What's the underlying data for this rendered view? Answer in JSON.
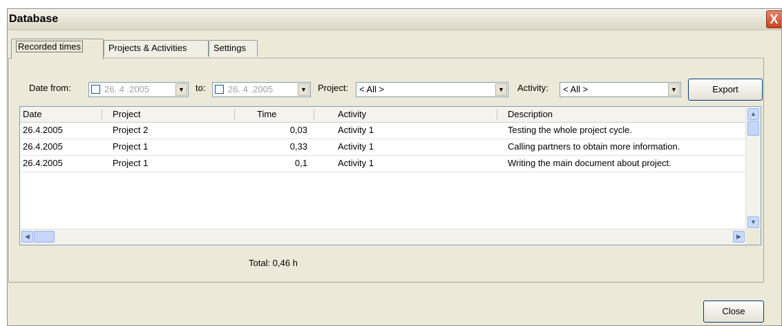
{
  "window": {
    "title": "Database",
    "close_glyph": "X"
  },
  "tabs": [
    {
      "label": "Recorded times",
      "active": true
    },
    {
      "label": "Projects & Activities",
      "active": false
    },
    {
      "label": "Settings",
      "active": false
    }
  ],
  "filters": {
    "date_from_label": "Date from:",
    "date_from_value": "26. 4 .2005",
    "to_label": "to:",
    "to_value": "26. 4 .2005",
    "project_label": "Project:",
    "project_value": "< All >",
    "activity_label": "Activity:",
    "activity_value": "< All >",
    "export_label": "Export"
  },
  "table": {
    "columns": [
      "Date",
      "Project",
      "Time",
      "Activity",
      "Description"
    ],
    "rows": [
      [
        "26.4.2005",
        "Project 2",
        "0,03",
        "Activity 1",
        "Testing the whole project cycle."
      ],
      [
        "26.4.2005",
        "Project 1",
        "0,33",
        "Activity 1",
        "Calling partners to obtain more information."
      ],
      [
        "26.4.2005",
        "Project 1",
        "0,1",
        "Activity 1",
        "Writing the main document about project."
      ]
    ]
  },
  "total_text": "Total: 0,46 h",
  "close_button_label": "Close",
  "icons": {
    "dropdown": "dropdown-arrow-icon",
    "scroll_up": "scroll-up-icon",
    "scroll_down": "scroll-down-icon",
    "scroll_left": "scroll-left-icon",
    "scroll_right": "scroll-right-icon",
    "close": "close-icon"
  }
}
